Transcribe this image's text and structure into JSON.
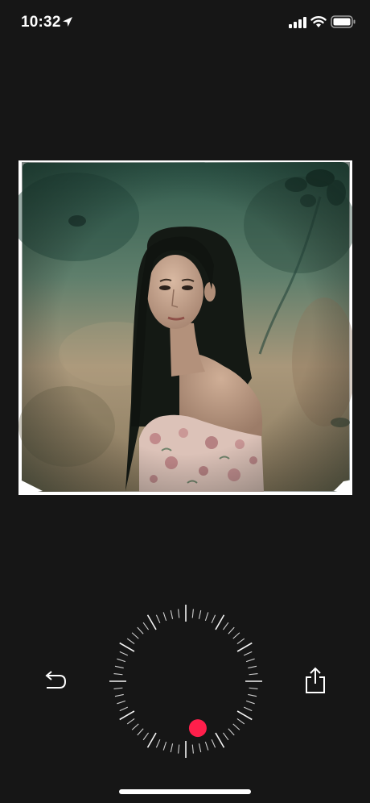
{
  "status_bar": {
    "time": "10:32",
    "icons": [
      "location-arrow-icon",
      "cellular-signal-icon",
      "wifi-icon",
      "battery-icon"
    ]
  },
  "photo": {
    "description_icon": "vintage-portrait-photo",
    "frame_color": "#ffffff"
  },
  "controls": {
    "undo_icon": "undo-arrow-icon",
    "share_icon": "share-icon",
    "dial": {
      "tick_count": 60,
      "indicator_color": "#ff1f4b",
      "indicator_level": 0.46
    }
  },
  "colors": {
    "background": "#161616",
    "foreground": "#ffffff",
    "accent": "#ff1f4b"
  }
}
